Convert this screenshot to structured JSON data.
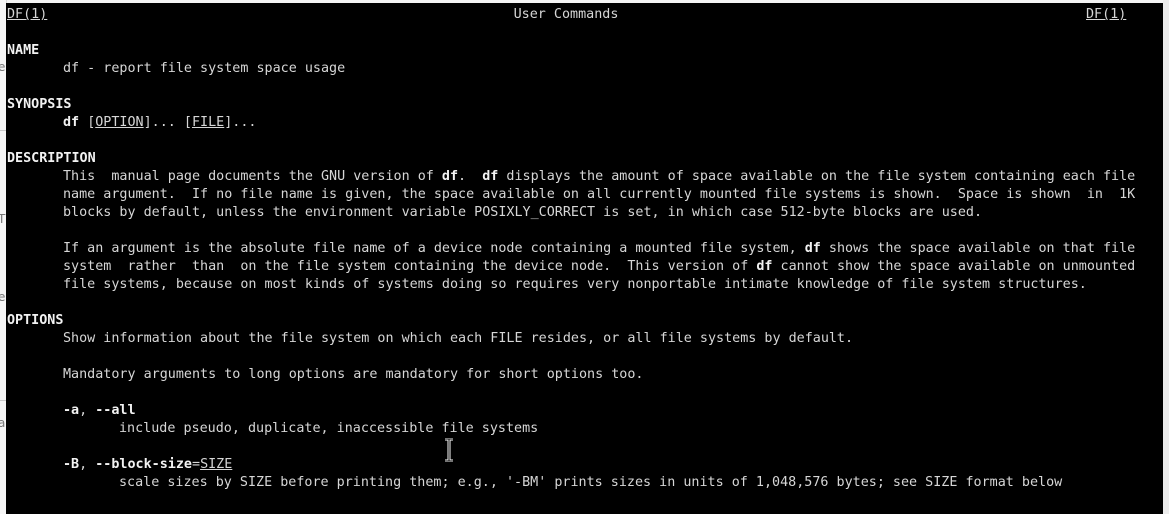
{
  "header": {
    "left": "DF(1)",
    "center": "User Commands",
    "right": "DF(1)"
  },
  "sections": {
    "name_heading": "NAME",
    "name_text": "df - report file system space usage",
    "synopsis_heading": "SYNOPSIS",
    "synopsis_cmd": "df",
    "synopsis_space1": " ",
    "synopsis_option": "OPTION",
    "synopsis_mid": "]... [",
    "synopsis_open": "[",
    "synopsis_file": "FILE",
    "synopsis_end": "]...",
    "description_heading": "DESCRIPTION",
    "desc_p1_l1_a": "This  manual page documents the GNU version of ",
    "desc_p1_l1_b": "df",
    "desc_p1_l1_c": ".  ",
    "desc_p1_l1_d": "df",
    "desc_p1_l1_e": " displays the amount of space available on the file system containing each file",
    "desc_p1_l2": "name argument.  If no file name is given, the space available on all currently mounted file systems is shown.  Space is shown  in  1K",
    "desc_p1_l3": "blocks by default, unless the environment variable POSIXLY_CORRECT is set, in which case 512-byte blocks are used.",
    "desc_p2_l1_a": "If an argument is the absolute file name of a device node containing a mounted file system, ",
    "desc_p2_l1_b": "df",
    "desc_p2_l1_c": " shows the space available on that file",
    "desc_p2_l2_a": "system  rather  than  on the file system containing the device node.  This version of ",
    "desc_p2_l2_b": "df",
    "desc_p2_l2_c": " cannot show the space available on unmounted",
    "desc_p2_l3": "file systems, because on most kinds of systems doing so requires very nonportable intimate knowledge of file system structures.",
    "options_heading": "OPTIONS",
    "opt_intro": "Show information about the file system on which each FILE resides, or all file systems by default.",
    "opt_mandatory": "Mandatory arguments to long options are mandatory for short options too.",
    "opt_a_short": "-a",
    "opt_a_sep": ", ",
    "opt_a_long": "--all",
    "opt_a_desc": "include pseudo, duplicate, inaccessible file systems",
    "opt_B_short": "-B",
    "opt_B_sep": ", ",
    "opt_B_long": "--block-size",
    "opt_B_eq": "=",
    "opt_B_arg": "SIZE",
    "opt_B_desc": "scale sizes by SIZE before printing them; e.g., '-BM' prints sizes in units of 1,048,576 bytes; see SIZE format below"
  },
  "background": {
    "glyphs": [
      "e",
      "T",
      "e",
      "a"
    ]
  },
  "colors": {
    "terminal_bg": "#000000",
    "terminal_fg": "#d6d6d6"
  }
}
